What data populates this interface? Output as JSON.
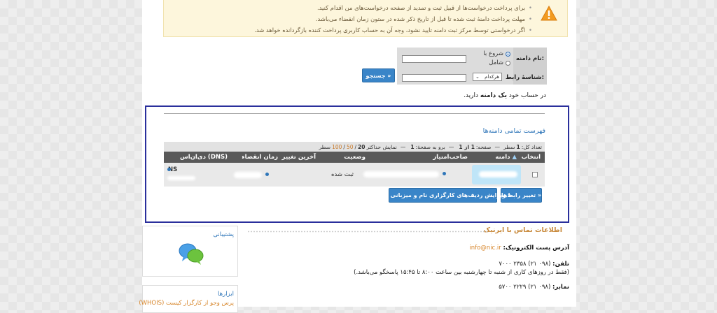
{
  "notice": {
    "items": [
      "برای پرداخت درخواست‌ها از قبیل ثبت و تمدید از صفحه درخواست‌های من اقدام کنید.",
      "مهلت پرداخت دامنهٔ ثبت شده تا قبل از تاریخ ذکر شده در ستون زمان انقضاء می‌باشد.",
      "اگر درخواستی توسط مرکز ثبت دامنه تایید نشود، وجه آن به حساب کاربری پرداخت کننده بازگردانده خواهد شد."
    ],
    "icon": "warning-triangle-icon"
  },
  "search": {
    "domain_label": "نام دامنه:",
    "handle_label": "شناسهٔ رابط:",
    "opt_starts": "شروع با",
    "opt_contains": "شامل",
    "select_value": "هرکدام",
    "button": "جستجو »"
  },
  "account": {
    "prefix": "در حساب خود",
    "count": "یک دامنه",
    "suffix": "دارید."
  },
  "domains": {
    "title": "فهرست تمامی دامنه‌ها",
    "info": {
      "total_label": "تعداد کل:",
      "total_value": "1",
      "total_unit": "سطر",
      "page_label": "صفحه:",
      "page_value": "1 از 1",
      "goto_label": "برو به صفحهٔ:",
      "goto_value": "1",
      "show_label": "نمایش حداکثر",
      "opt1": "20",
      "opt2": "50",
      "opt3": "100",
      "rows_unit": "سطر"
    },
    "columns": {
      "select": "انتخاب",
      "domain": "دامنه",
      "holder": "صاحب‌امتیاز",
      "status": "وضعیت",
      "last_change": "آخرین تغییر",
      "expiry": "زمان انقضاء",
      "dns": "دی‌ان‌اس (DNS)"
    },
    "row": {
      "status": "ثبت شده",
      "ns": "NS"
    },
    "btn_change_handles": "تغییر رابط‌ها »",
    "btn_edit_dns": "ویرایش ردیف‌های کارگزاری نام و میزبانی دامنه »"
  },
  "contact": {
    "title": "اطلاعات تماس با ایرنیک",
    "email_label": "آدرس پست الکترونیک:",
    "email": "info@nic.ir",
    "phone_label": "تلفن:",
    "phone": "(۰۹۸ ۲۱) ۲۳۵۸ ۷۰۰۰",
    "hours": "(فقط در روزهای کاری از شنبه تا چهارشنبه بین ساعت ۸:۰۰ تا ۱۵:۴۵ پاسخگو می‌باشد.)",
    "fax_label": "نمابر:",
    "fax": "(۰۹۸ ۲۱) ۲۲۲۹ ۵۷۰۰"
  },
  "sidebar": {
    "support_title": "پشتیبانی",
    "support_icon": "chat-bubbles-icon",
    "tools_title": "ابزارها",
    "tools_link": "پرس وجو از کارگزار کیست (WHOIS)"
  }
}
